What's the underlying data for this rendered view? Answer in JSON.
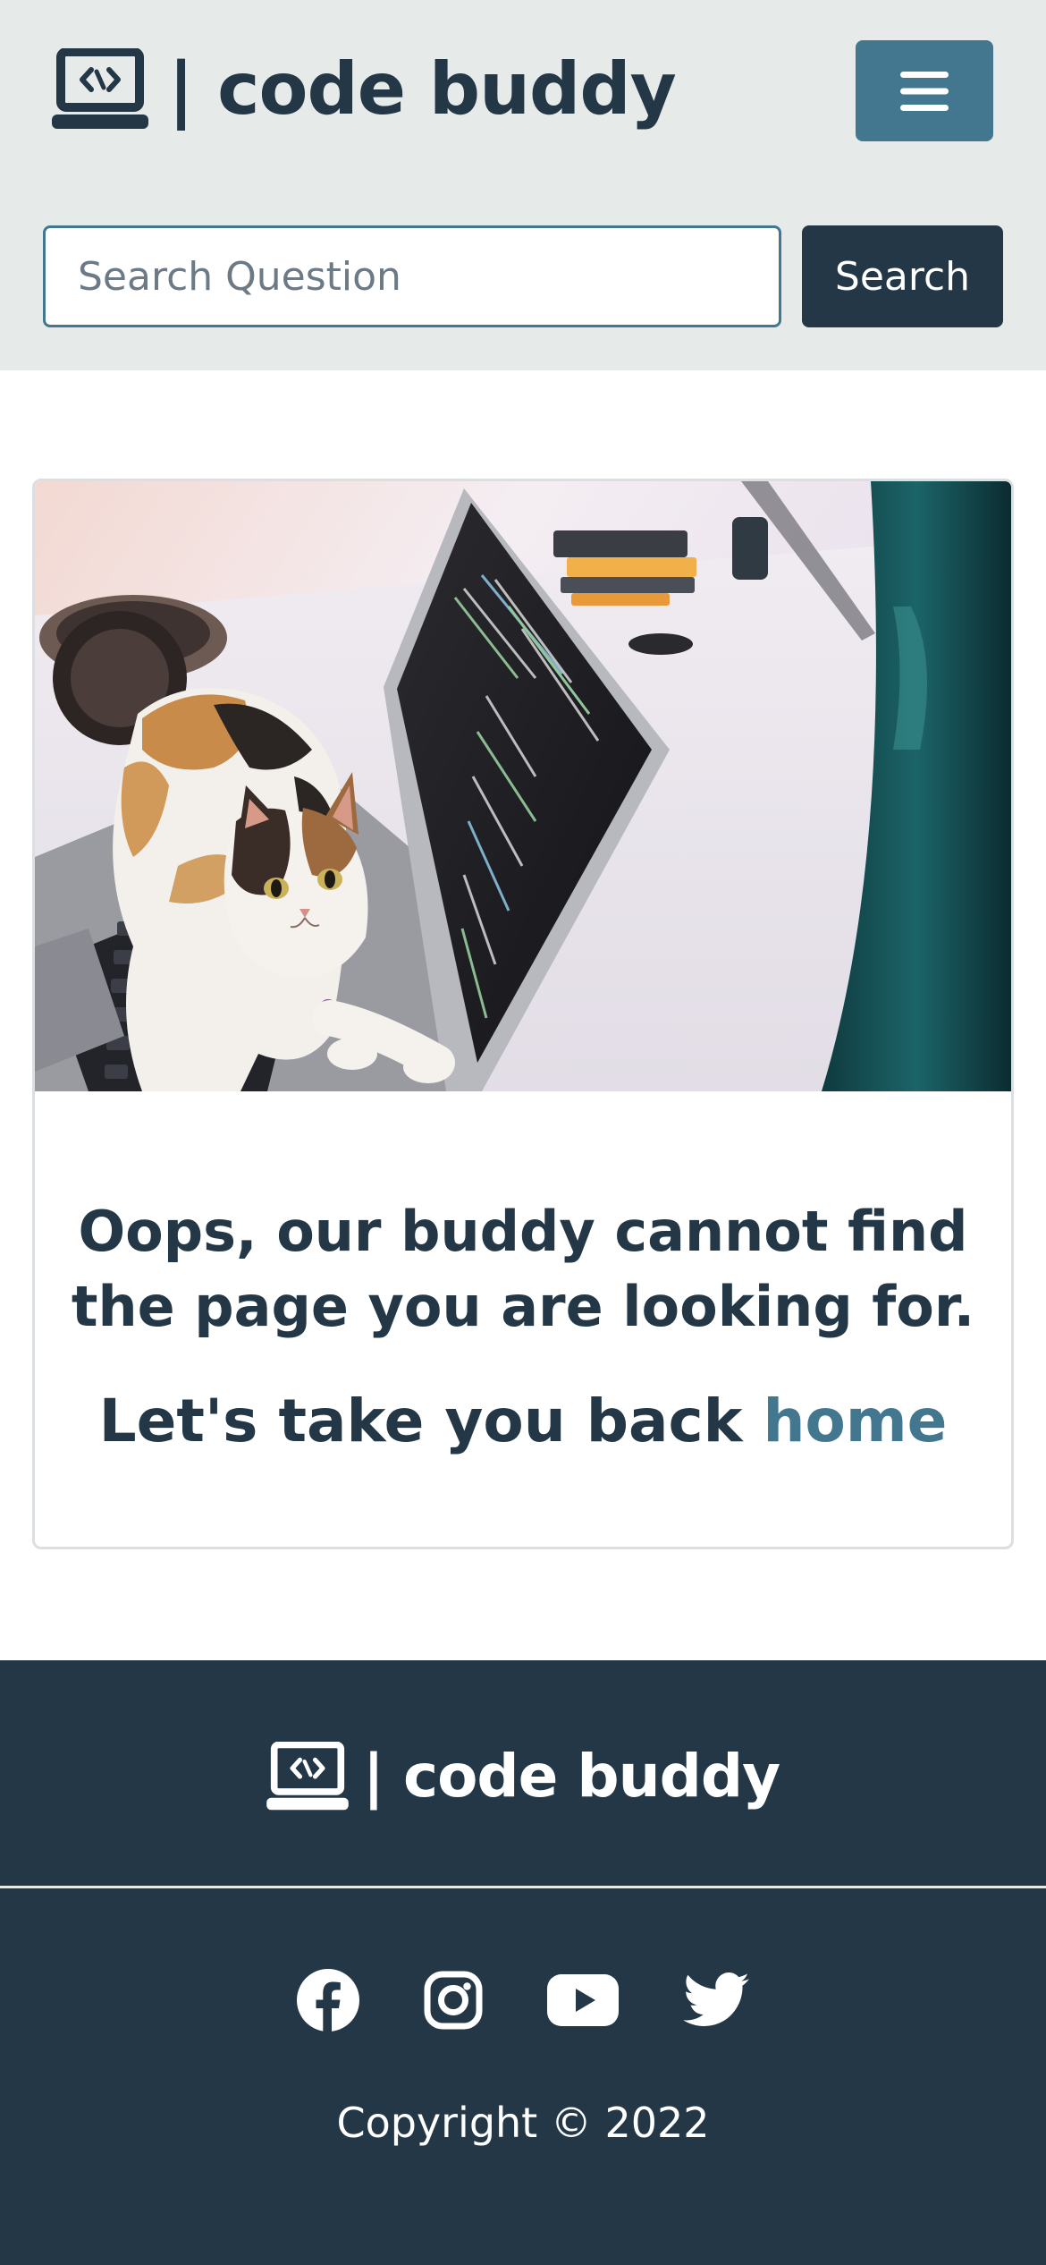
{
  "header": {
    "brand_text": "| code buddy",
    "menu_icon": "hamburger-icon",
    "search": {
      "placeholder": "Search Question",
      "button_label": "Search"
    }
  },
  "card": {
    "image_alt": "Calico cat sitting on a laptop keyboard",
    "title": "Oops, our buddy cannot find the page you are looking for.",
    "back_text": "Let's take you back ",
    "home_link": "home"
  },
  "footer": {
    "brand_text": "| code buddy",
    "socials": [
      {
        "name": "facebook-icon"
      },
      {
        "name": "instagram-icon"
      },
      {
        "name": "youtube-icon"
      },
      {
        "name": "twitter-icon"
      }
    ],
    "copyright": "Copyright © 2022"
  },
  "colors": {
    "header_bg": "#e6ebea",
    "primary_dark": "#233746",
    "accent": "#42778f",
    "footer_bg": "#233746"
  }
}
